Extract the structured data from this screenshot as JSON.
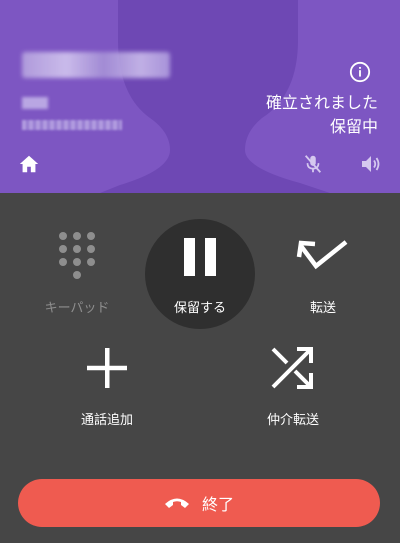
{
  "header": {
    "status_connected": "確立されました",
    "status_hold": "保留中"
  },
  "icons": {
    "info": "info-icon",
    "home": "home-icon",
    "mic_off": "mic-off-icon",
    "speaker": "speaker-icon",
    "dialpad": "dialpad-icon",
    "pause": "pause-icon",
    "transfer": "transfer-icon",
    "add_call": "plus-icon",
    "merge_transfer": "shuffle-icon",
    "end_call": "phone-hangup-icon"
  },
  "controls": {
    "keypad_label": "キーパッド",
    "hold_label": "保留する",
    "transfer_label": "転送",
    "add_call_label": "通話追加",
    "consult_transfer_label": "仲介転送",
    "end_call_label": "終了"
  },
  "colors": {
    "header_bg": "#7d56c2",
    "panel_bg": "#464646",
    "hold_active_bg": "#2f2f2f",
    "end_call_bg": "#ef5b50"
  }
}
